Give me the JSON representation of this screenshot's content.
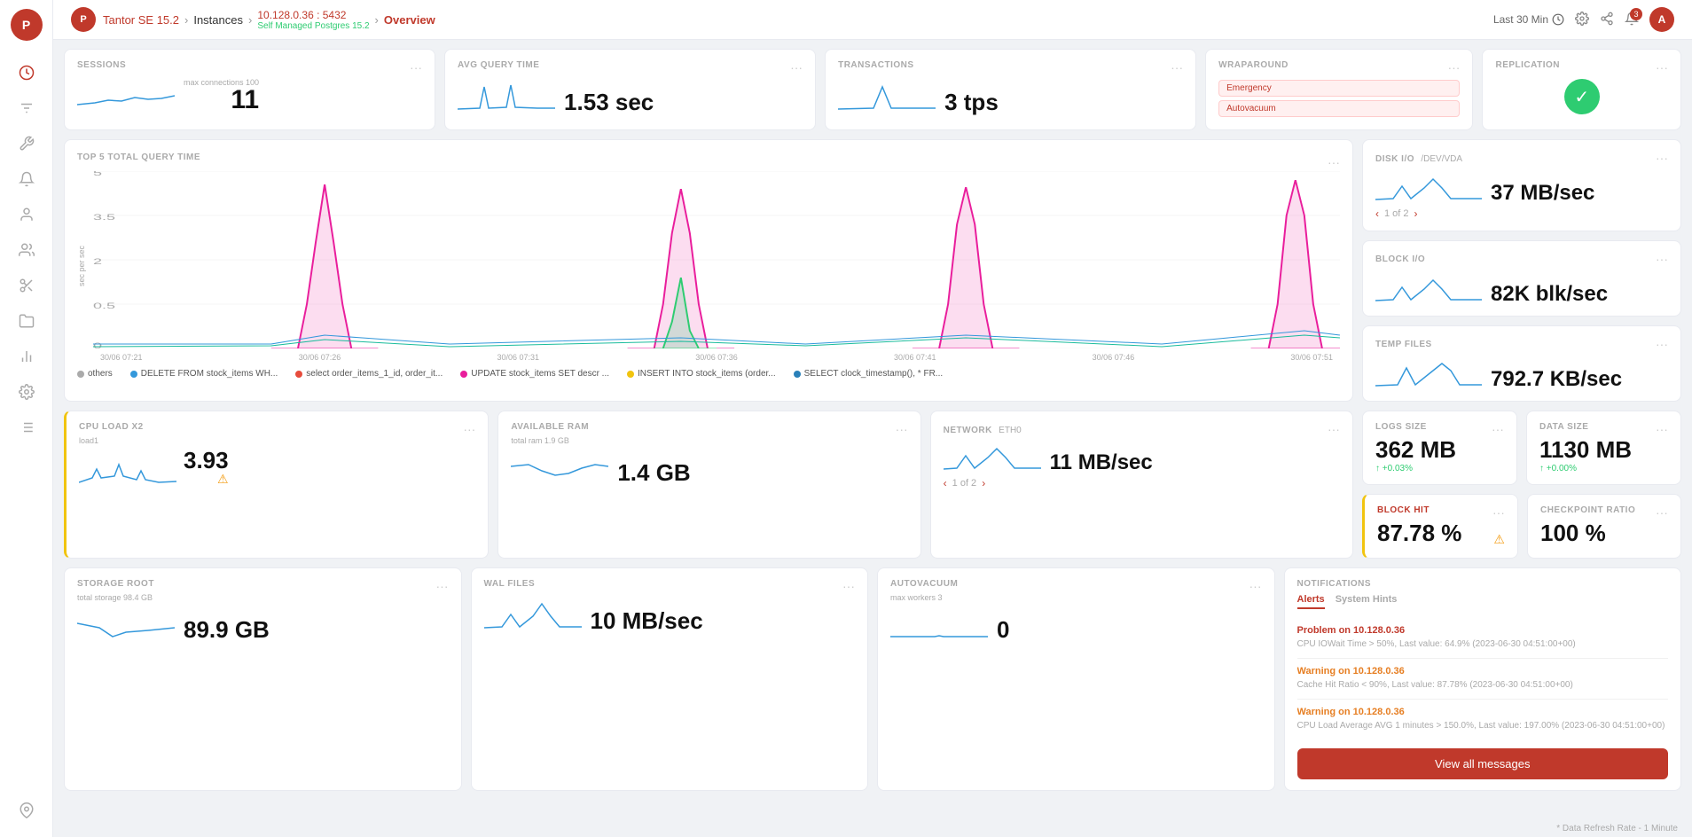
{
  "app": {
    "logo": "P",
    "nav": {
      "breadcrumb1": "Tantor SE 15.2",
      "sep1": "›",
      "breadcrumb2": "Instances",
      "sep2": "›",
      "instance_ip": "10.128.0.36 : 5432",
      "instance_sub": "Self Managed Postgres 15.2",
      "sep3": "›",
      "current": "Overview"
    },
    "header": {
      "time_label": "Last 30 Min",
      "notif_count": "3",
      "user_initial": "A"
    },
    "footer_note": "* Data Refresh Rate - 1 Minute"
  },
  "metrics": {
    "sessions": {
      "title": "SESSIONS",
      "sub": "max connections 100",
      "value": "11"
    },
    "avg_query": {
      "title": "AVG QUERY TIME",
      "value": "1.53 sec"
    },
    "transactions": {
      "title": "TRANSACTIONS",
      "value": "3 tps"
    },
    "wraparound": {
      "title": "WRAPAROUND",
      "tag1": "Emergency",
      "tag2": "Autovacuum"
    },
    "replication": {
      "title": "REPLICATION"
    },
    "top5_query": {
      "title": "TOP 5 TOTAL QUERY TIME",
      "y_label": "sec per sec",
      "legend": [
        {
          "color": "#aaa",
          "text": "others"
        },
        {
          "color": "#3498db",
          "text": "DELETE FROM stock_items WH..."
        },
        {
          "color": "#e74c3c",
          "text": "select order_items_1_id, order_it..."
        },
        {
          "color": "#e91e9c",
          "text": "UPDATE stock_items SET descr ..."
        },
        {
          "color": "#f1c40f",
          "text": "INSERT INTO stock_items (order..."
        },
        {
          "color": "#2980b9",
          "text": "SELECT clock_timestamp(), * FR..."
        }
      ]
    },
    "disk_io": {
      "title": "DISK I/O",
      "subtitle": "/DEV/VDA",
      "value": "37 MB/sec",
      "pagination": "1 of 2"
    },
    "logs_size": {
      "title": "LOGS SIZE",
      "value": "362 MB",
      "change": "+0.03%"
    },
    "data_size": {
      "title": "DATA SIZE",
      "value": "1130 MB",
      "change": "+0.00%"
    },
    "block_io": {
      "title": "BLOCK I/O",
      "value": "82K blk/sec"
    },
    "block_hit": {
      "title": "BLOCK HIT",
      "value": "87.78 %",
      "warning": true
    },
    "checkpoint_ratio": {
      "title": "CHECKPOINT RATIO",
      "value": "100 %"
    },
    "temp_files": {
      "title": "TEMP FILES",
      "value": "792.7 KB/sec"
    },
    "cpu_load": {
      "title": "CPU LOAD X2",
      "sub": "load1",
      "value": "3.93",
      "warning": true
    },
    "available_ram": {
      "title": "AVAILABLE RAM",
      "sub": "total ram 1.9 GB",
      "value": "1.4 GB"
    },
    "network": {
      "title": "NETWORK",
      "subtitle": "ETH0",
      "value": "11 MB/sec",
      "pagination": "1 of 2"
    },
    "storage_root": {
      "title": "STORAGE ROOT",
      "sub": "total storage 98.4 GB",
      "value": "89.9 GB"
    },
    "wal_files": {
      "title": "WAL FILES",
      "value": "10 MB/sec"
    },
    "autovacuum": {
      "title": "AUTOVACUUM",
      "sub": "max workers 3",
      "value": "0"
    }
  },
  "notifications": {
    "title": "NOTIFICATIONS",
    "tab_alerts": "Alerts",
    "tab_hints": "System Hints",
    "items": [
      {
        "type": "problem",
        "title": "Problem on 10.128.0.36",
        "desc": "CPU IOWait Time > 50%, Last value: 64.9% (2023-06-30 04:51:00+00)"
      },
      {
        "type": "warning",
        "title": "Warning on 10.128.0.36",
        "desc": "Cache Hit Ratio < 90%, Last value: 87.78% (2023-06-30 04:51:00+00)"
      },
      {
        "type": "warning",
        "title": "Warning on 10.128.0.36",
        "desc": "CPU Load Average AVG 1 minutes > 150.0%, Last value: 197.00% (2023-06-30 04:51:00+00)"
      }
    ],
    "view_all": "View all messages"
  },
  "sidebar": {
    "logo": "P",
    "icons": [
      "⚙",
      "≡",
      "⚡",
      "📢",
      "👤",
      "👥",
      "✂",
      "📁",
      "📊",
      "⚙",
      "☰",
      "📌"
    ]
  }
}
